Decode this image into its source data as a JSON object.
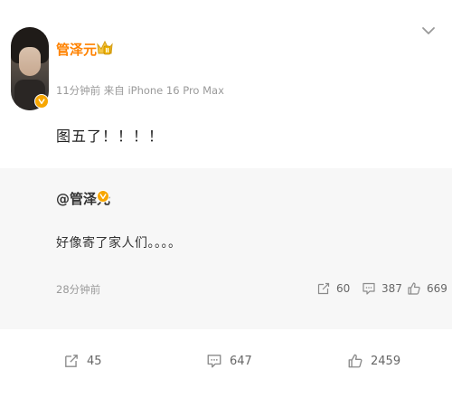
{
  "post": {
    "author": "管泽元",
    "meta": "11分钟前 来自 iPhone 16 Pro Max",
    "text": "图五了！！！！"
  },
  "repost": {
    "author": "@管泽元",
    "text": "好像寄了家人们。。。。",
    "time": "28分钟前",
    "stats": {
      "reposts": "60",
      "comments": "387",
      "likes": "669"
    }
  },
  "actions": {
    "reposts": "45",
    "comments": "647",
    "likes": "2459"
  },
  "colors": {
    "username": "#ff8200",
    "verified_badge": "#f7a600",
    "repost_bg": "#f7f7f7",
    "meta": "#9a9a9a"
  },
  "icons": {
    "crown": "crown-icon",
    "verified": "verified-v-icon",
    "menu": "chevron-down-icon",
    "repost": "repost-icon",
    "comment": "comment-icon",
    "like": "thumbs-up-icon"
  }
}
